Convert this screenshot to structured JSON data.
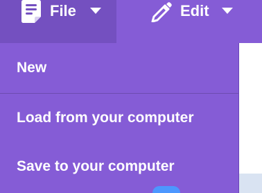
{
  "menubar": {
    "file_label": "File",
    "edit_label": "Edit",
    "file_icon": "file-icon",
    "edit_icon": "pencil-icon",
    "caret_icon": "caret-down-icon"
  },
  "dropdown": {
    "items": [
      {
        "label": "New"
      },
      {
        "label": "Load from your computer"
      },
      {
        "label": "Save to your computer"
      }
    ]
  },
  "colors": {
    "menubar_bg": "#855cd6",
    "menubar_active_bg": "#7450c0",
    "text": "#ffffff"
  }
}
